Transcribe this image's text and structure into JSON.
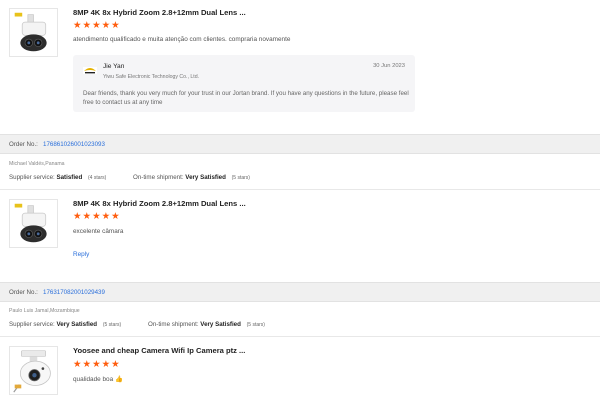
{
  "reviews": [
    {
      "product_title": "8MP 4K 8x Hybrid Zoom 2.8+12mm Dual Lens ...",
      "stars": 5,
      "comment": "atendimento qualificado e muita atenção com clientes. compraria novamente",
      "seller_reply": {
        "name": "Jie Yan",
        "company": "Yiwu Safe Electronic Technology Co., Ltd.",
        "date": "30 Jun 2023",
        "message": "Dear friends, thank you very much for your trust in our Jortan brand. If you have any questions in the future, please feel free to contact us at any time"
      }
    },
    {
      "order_label": "Order No.:",
      "order_number": "176861026001023093",
      "buyer": "Michael Valdés,Panama",
      "supplier_service_label": "Supplier service:",
      "supplier_service_value": "Satisfied",
      "supplier_service_stars": "(4 stars)",
      "shipment_label": "On-time shipment:",
      "shipment_value": "Very Satisfied",
      "shipment_stars": "(5 stars)",
      "product_title": "8MP 4K 8x Hybrid Zoom 2.8+12mm Dual Lens ...",
      "stars": 5,
      "comment": "excelente câmara",
      "reply_label": "Reply"
    },
    {
      "order_label": "Order No.:",
      "order_number": "176317082001029439",
      "buyer": "Paulo Luis Jamal,Mozambique",
      "supplier_service_label": "Supplier service:",
      "supplier_service_value": "Very Satisfied",
      "supplier_service_stars": "(5 stars)",
      "shipment_label": "On-time shipment:",
      "shipment_value": "Very Satisfied",
      "shipment_stars": "(5 stars)",
      "product_title": "Yoosee and cheap Camera Wifi Ip Camera ptz ...",
      "stars": 5,
      "comment": "qualidade boa",
      "comment_emoji": "👍"
    }
  ],
  "icons": {
    "star": "star-icon",
    "thumbs_up": "thumbs-up-icon",
    "seller_logo": "jortan-logo"
  },
  "colors": {
    "star": "#ff5d0e",
    "link": "#2a6fdb",
    "order_bar": "#f0f0f0"
  }
}
